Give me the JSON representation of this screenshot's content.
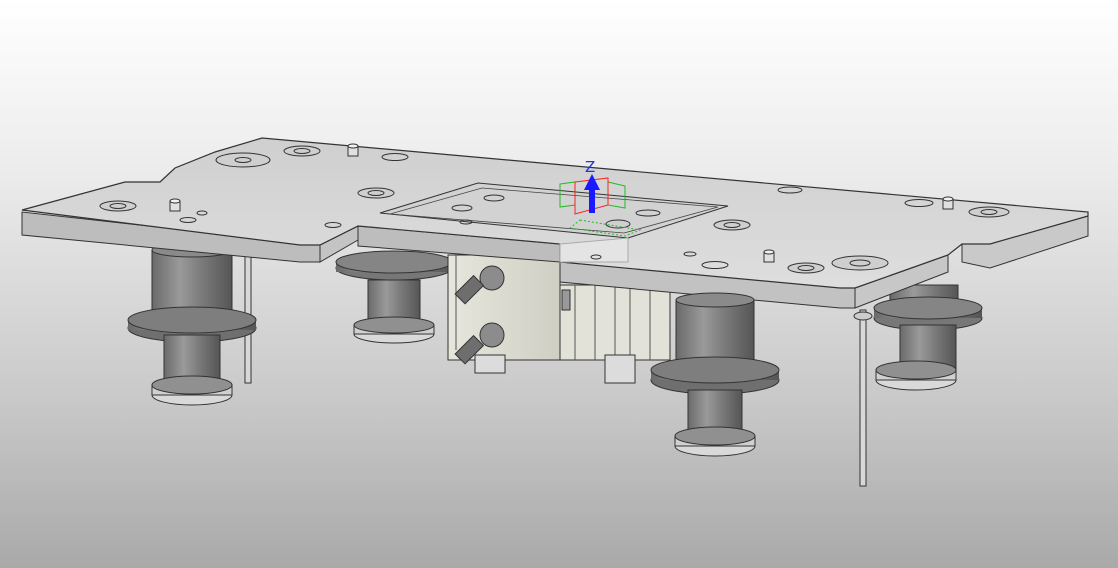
{
  "viewport": {
    "background_top": "#ffffff",
    "background_bottom": "#a9a9a9",
    "model_color": "#d6d6d6",
    "edge_color": "#2a2a2a"
  },
  "triad": {
    "z_label": "Z",
    "colors": {
      "z": "#1a1aff",
      "x": "#ff2222",
      "y": "#22bb22"
    }
  },
  "model": {
    "description_icons": [
      "base-plate",
      "guide-bushing",
      "pneumatic-cylinder",
      "elbow-fitting",
      "guide-rod",
      "dowel-pin"
    ]
  }
}
